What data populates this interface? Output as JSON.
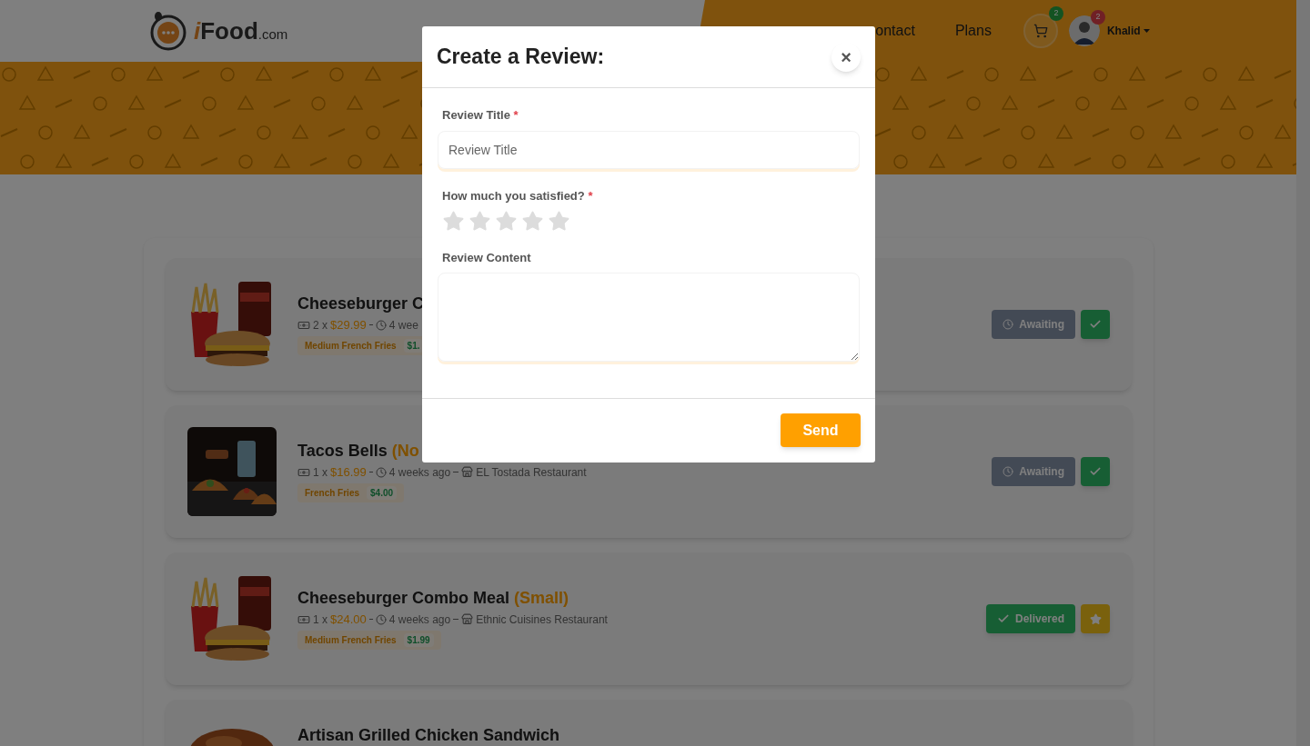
{
  "header": {
    "logo": {
      "initial": "i",
      "name": "Food",
      "suffix": ".com"
    },
    "nav": [
      {
        "label": "ontact"
      },
      {
        "label": "Plans"
      }
    ],
    "cart": {
      "count": "2"
    },
    "user": {
      "name": "Khalid",
      "badge": "2"
    }
  },
  "orders": [
    {
      "picture": {
        "kind": "combo"
      },
      "title": "Cheeseburger C",
      "quantity": "2 x",
      "price": "$29.99",
      "time": "4 wee",
      "extras": [
        {
          "name": "Medium French Fries",
          "price": "$1."
        }
      ],
      "status": {
        "kind": "awaiting",
        "label": "Awaiting"
      },
      "action": {
        "kind": "confirm"
      }
    },
    {
      "picture": {
        "kind": "tacos"
      },
      "title": "Tacos Bells",
      "size": "(No",
      "quantity": "1 x",
      "price": "$16.99",
      "time": "4 weeks ago",
      "restaurant": "EL Tostada Restaurant",
      "extras": [
        {
          "name": "French Fries",
          "price": "$4.00"
        }
      ],
      "status": {
        "kind": "awaiting",
        "label": "Awaiting"
      },
      "action": {
        "kind": "confirm"
      }
    },
    {
      "picture": {
        "kind": "combo"
      },
      "title": "Cheeseburger Combo Meal",
      "size": "(Small)",
      "quantity": "1 x",
      "price": "$24.00",
      "time": "4 weeks ago",
      "restaurant": "Ethnic Cuisines Restaurant",
      "extras": [
        {
          "name": "Medium French Fries",
          "price": "$1.99"
        }
      ],
      "status": {
        "kind": "delivered",
        "label": "Delivered"
      },
      "action": {
        "kind": "rate"
      }
    },
    {
      "picture": {
        "kind": "bun"
      },
      "title": "Artisan Grilled Chicken Sandwich"
    }
  ],
  "review": {
    "title": "Create a Review:",
    "close": "×",
    "title_field": {
      "label": "Review Title",
      "required": "*",
      "placeholder": "Review Title"
    },
    "rating": {
      "label": "How much you satisfied?",
      "required": "*",
      "stars": 0
    },
    "content_field": {
      "label": "Review Content"
    },
    "send": "Send"
  }
}
